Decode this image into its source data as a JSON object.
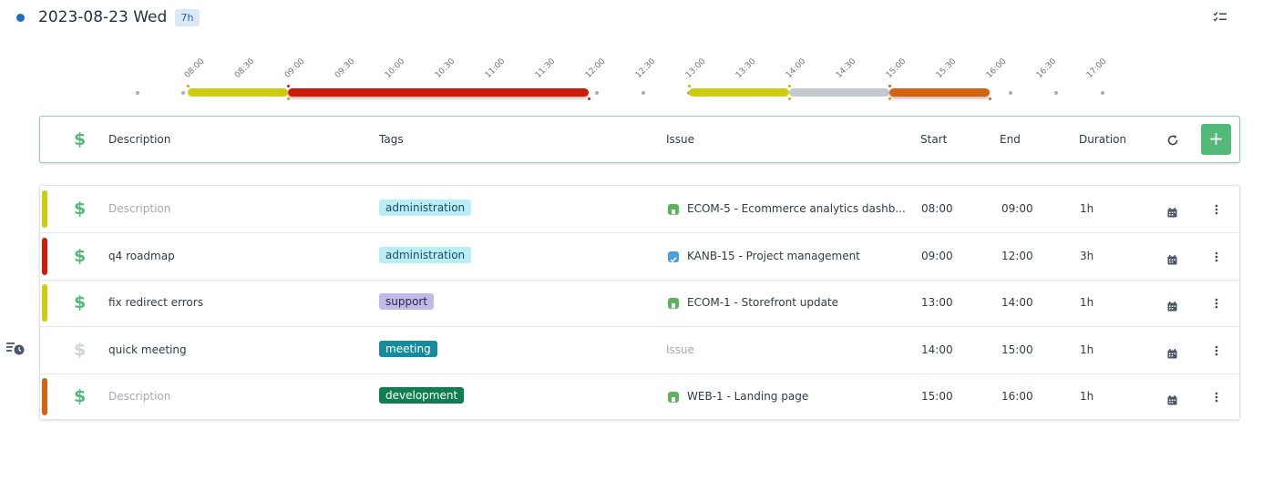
{
  "header": {
    "date_title": "2023-08-23 Wed",
    "total_badge": "7h",
    "icons": {
      "status_dot": "status-dot-icon",
      "checklist": "checklist-icon"
    },
    "colors": {
      "accent": "#1f6fc0",
      "badge_bg": "#dbe9f6"
    }
  },
  "timeline": {
    "ticks": [
      "08:00",
      "08:30",
      "09:00",
      "09:30",
      "10:00",
      "10:30",
      "11:00",
      "11:30",
      "12:00",
      "12:30",
      "13:00",
      "13:30",
      "14:00",
      "14:30",
      "15:00",
      "15:30",
      "16:00",
      "16:30",
      "17:00"
    ],
    "segments": [
      {
        "start": "08:00",
        "end": "09:00",
        "color": "#cccc11"
      },
      {
        "start": "09:00",
        "end": "12:00",
        "color": "#cc1d0c"
      },
      {
        "start": "13:00",
        "end": "14:00",
        "color": "#cccc11"
      },
      {
        "start": "14:00",
        "end": "15:00",
        "color": "#c3c8ce"
      },
      {
        "start": "15:00",
        "end": "16:00",
        "color": "#d26310"
      }
    ]
  },
  "columns": {
    "description": "Description",
    "tags": "Tags",
    "issue": "Issue",
    "start": "Start",
    "end": "End",
    "duration": "Duration",
    "add_label": "+",
    "refresh_icon": "refresh-icon"
  },
  "entries": [
    {
      "color": "#cccc11",
      "billable": true,
      "description": "Description",
      "description_placeholder": true,
      "tag": "administration",
      "tag_bg": "#b9eef7",
      "tag_fg": "#1c4e63",
      "issue": "ECOM-5 - Ecommerce analytics dashb...",
      "issue_icon": "story-icon",
      "issue_icon_color": "#5db35b",
      "start": "08:00",
      "end": "09:00",
      "duration": "1h"
    },
    {
      "color": "#cc1d0c",
      "billable": true,
      "description": "q4 roadmap",
      "description_placeholder": false,
      "tag": "administration",
      "tag_bg": "#b9eef7",
      "tag_fg": "#1c4e63",
      "issue": "KANB-15 - Project management",
      "issue_icon": "task-icon",
      "issue_icon_color": "#4b9ed9",
      "start": "09:00",
      "end": "12:00",
      "duration": "3h"
    },
    {
      "color": "#cccc11",
      "billable": true,
      "description": "fix redirect errors",
      "description_placeholder": false,
      "tag": "support",
      "tag_bg": "#c3b9e6",
      "tag_fg": "#2f2450",
      "issue": "ECOM-1 - Storefront update",
      "issue_icon": "story-icon",
      "issue_icon_color": "#5db35b",
      "start": "13:00",
      "end": "14:00",
      "duration": "1h"
    },
    {
      "color": "",
      "billable": false,
      "description": "quick meeting",
      "description_placeholder": false,
      "tag": "meeting",
      "tag_bg": "#178a9c",
      "tag_fg": "#ffffff",
      "issue": "Issue",
      "issue_placeholder": true,
      "issue_icon": "",
      "issue_icon_color": "",
      "start": "14:00",
      "end": "15:00",
      "duration": "1h"
    },
    {
      "color": "#d26310",
      "billable": true,
      "description": "Description",
      "description_placeholder": true,
      "tag": "development",
      "tag_bg": "#0e7f4f",
      "tag_fg": "#ffffff",
      "issue": "WEB-1 - Landing page",
      "issue_icon": "story-icon",
      "issue_icon_color": "#5db35b",
      "start": "15:00",
      "end": "16:00",
      "duration": "1h"
    }
  ],
  "side": {
    "icon": "scheduled-list-icon"
  }
}
